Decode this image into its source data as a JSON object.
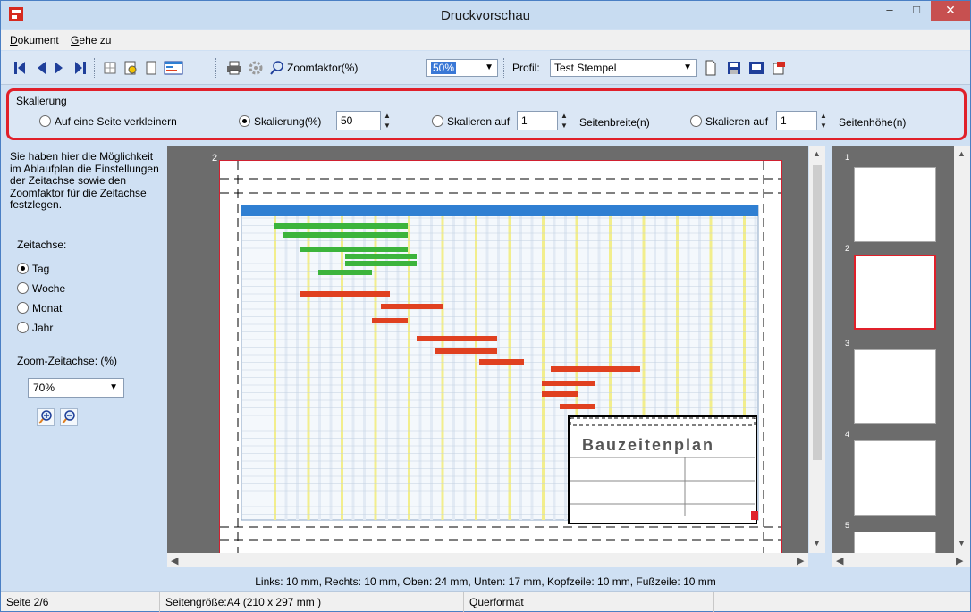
{
  "window": {
    "title": "Druckvorschau",
    "minimize_glyph": "–",
    "maximize_glyph": "□",
    "close_glyph": "✕"
  },
  "menu": {
    "items": [
      {
        "accel": "D",
        "rest": "okument"
      },
      {
        "accel": "G",
        "rest": "ehe zu"
      }
    ]
  },
  "toolbar": {
    "zoom_label": "Zoomfaktor(%)",
    "zoom_value": "50%",
    "profile_label": "Profil:",
    "profile_value": "Test Stempel",
    "icons": [
      "first-page-icon",
      "previous-page-icon",
      "next-page-icon",
      "last-page-icon",
      "page-setup-icon",
      "print-icon",
      "search-icon",
      "new-document-icon",
      "save-icon",
      "save-as-icon",
      "delete-icon"
    ]
  },
  "scaling": {
    "title": "Skalierung",
    "option_fit": "Auf eine Seite verkleinern",
    "option_percent": "Skalierung(%)",
    "percent_value": "50",
    "option_scale_width": "Skalieren auf",
    "width_value": "1",
    "width_unit": "Seitenbreite(n)",
    "option_scale_height": "Skalieren auf",
    "height_value": "1",
    "height_unit": "Seitenhöhe(n)",
    "selected": "Skalierung(%)"
  },
  "left_panel": {
    "help_text": "Sie haben hier die Möglichkeit im Ablaufplan die Einstellungen der Zeitachse sowie den Zoomfaktor für die Zeitachse festzlegen.",
    "timeaxis_label": "Zeitachse:",
    "timeaxis_options": [
      "Tag",
      "Woche",
      "Monat",
      "Jahr"
    ],
    "timeaxis_selected": "Tag",
    "zoom_label": "Zoom-Zeitachse: (%)",
    "zoom_value": "70%"
  },
  "preview": {
    "page_number": "2",
    "title_block_heading": "Bauzeitenplan",
    "thumbnails": [
      "1",
      "2",
      "3",
      "4",
      "5"
    ]
  },
  "margins": "Links: 10 mm, Rechts: 10 mm, Oben: 24 mm, Unten: 17 mm, Kopfzeile: 10 mm, Fußzeile: 10 mm",
  "status": {
    "page": "Seite 2/6",
    "page_size": "Seitengröße:A4 (210 x 297 mm )",
    "orientation": "Querformat"
  },
  "colors": {
    "accent_red": "#e0202a",
    "gantt_green": "#3cb43c",
    "gantt_red": "#e04020",
    "header_blue": "#2f7fd2"
  }
}
